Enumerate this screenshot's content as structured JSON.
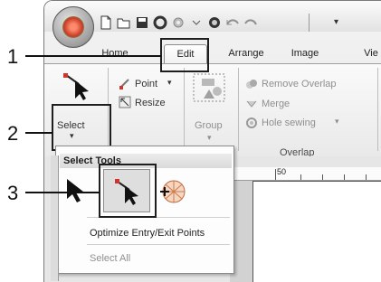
{
  "window": {
    "qat_icons": [
      "new-icon",
      "open-icon",
      "save-icon",
      "stop-icon",
      "gear-icon",
      "record-icon",
      "undo-icon",
      "redo-icon"
    ]
  },
  "tabs": [
    {
      "label": "Home"
    },
    {
      "label": "Edit"
    },
    {
      "label": "Arrange"
    },
    {
      "label": "Image"
    },
    {
      "label": "Vie"
    }
  ],
  "ribbon": {
    "select_label": "Select",
    "point_label": "Point",
    "resize_label": "Resize",
    "group_label": "Group",
    "remove_overlap_label": "Remove Overlap",
    "merge_label": "Merge",
    "hole_sewing_label": "Hole sewing",
    "overlap_group_title": "Overlap"
  },
  "popup": {
    "title": "Select Tools",
    "items": [
      "Optimize Entry/Exit Points",
      "Select All"
    ]
  },
  "ruler": {
    "mark": "50"
  },
  "callouts": [
    "1",
    "2",
    "3"
  ],
  "colors": {
    "accent": "#2a2a2a",
    "highlight": "#e8e8e8"
  }
}
